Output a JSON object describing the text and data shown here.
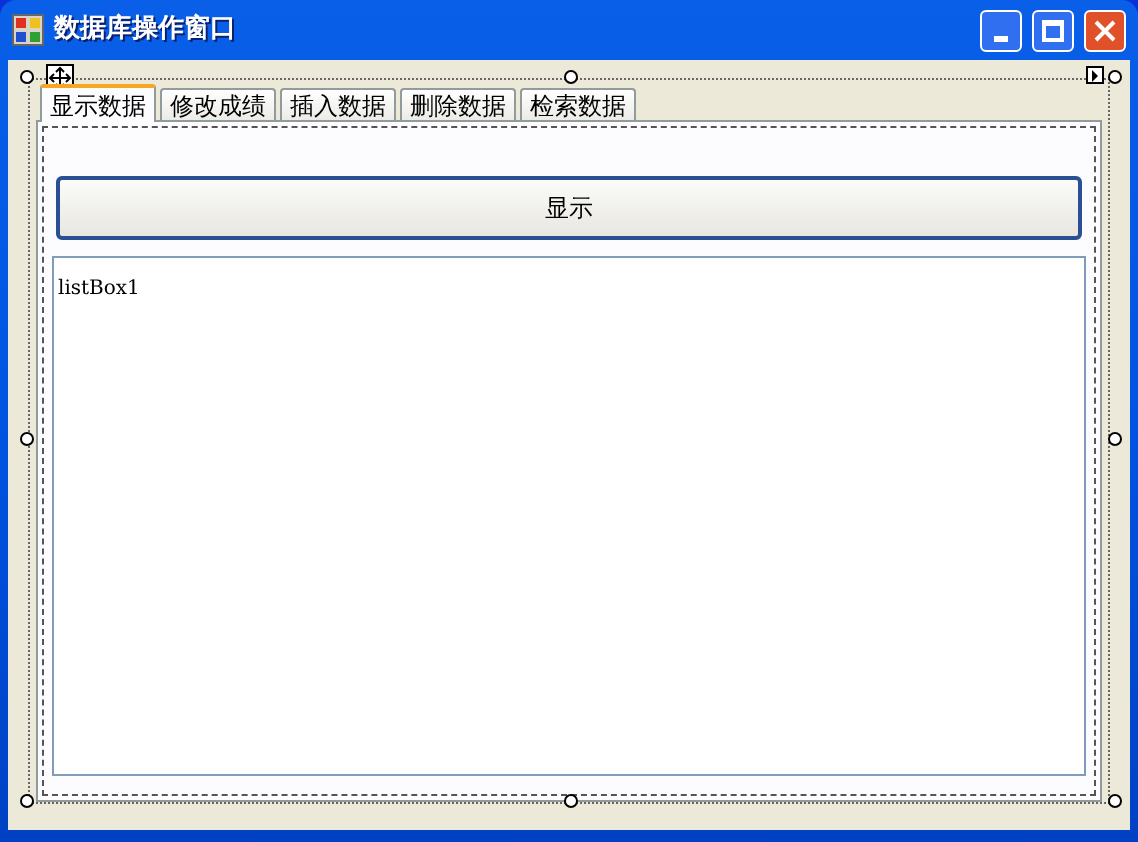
{
  "window": {
    "title": "数据库操作窗口"
  },
  "tabs": [
    {
      "label": "显示数据",
      "selected": true
    },
    {
      "label": "修改成绩",
      "selected": false
    },
    {
      "label": "插入数据",
      "selected": false
    },
    {
      "label": "删除数据",
      "selected": false
    },
    {
      "label": "检索数据",
      "selected": false
    }
  ],
  "button": {
    "label": "显示"
  },
  "list_box": {
    "text": "listBox1"
  }
}
